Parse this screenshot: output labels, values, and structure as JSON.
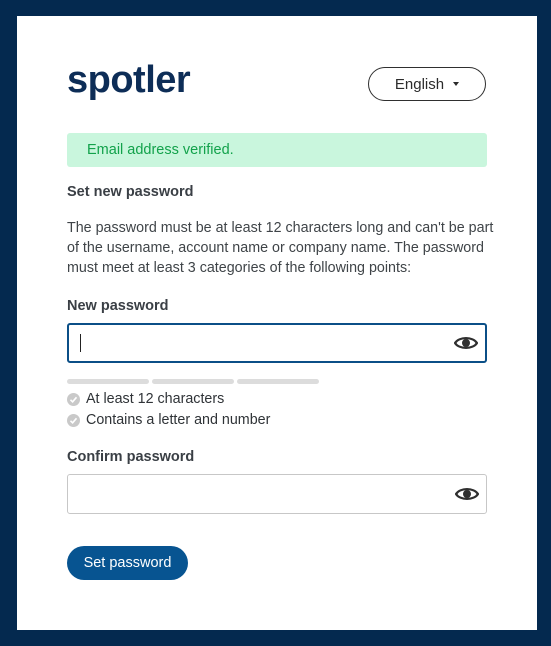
{
  "brand": {
    "logo_text": "spotler",
    "color": "#0d2d57"
  },
  "language": {
    "selected": "English",
    "icon": "caret-down-icon"
  },
  "alert": {
    "text": "Email address verified.",
    "status": "success",
    "bg_color": "#c9f6dd",
    "text_color": "#12a24b"
  },
  "form": {
    "heading": "Set new password",
    "description": "The password must be at least 12 characters long and can't be part of the username, account name or company name. The password must meet at least 3 categories of the following points:",
    "new_password": {
      "label": "New password",
      "value": "",
      "icon": "eye-icon"
    },
    "strength_meter": {
      "segments": 3,
      "filled": 0
    },
    "requirements": [
      {
        "text": "At least 12 characters",
        "met": false
      },
      {
        "text": "Contains a letter and number",
        "met": false
      }
    ],
    "confirm_password": {
      "label": "Confirm password",
      "value": "",
      "icon": "eye-icon"
    },
    "submit_label": "Set password"
  },
  "colors": {
    "background": "#04294f",
    "primary_button": "#075491",
    "focus_border": "#0b4f87"
  }
}
